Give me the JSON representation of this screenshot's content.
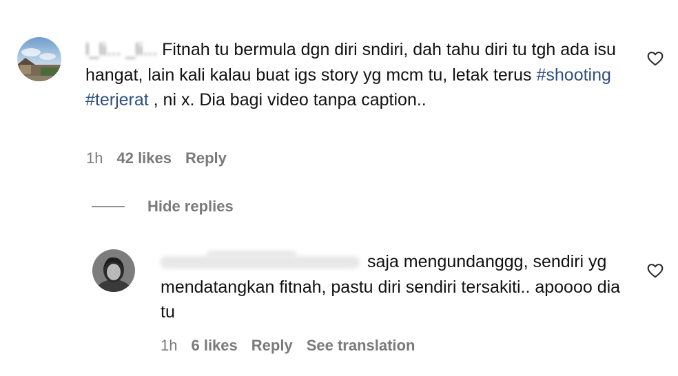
{
  "comments": [
    {
      "username": "l_li... _li...",
      "text_before": "Fitnah tu bermula dgn diri sndiri, dah tahu diri tu tgh ada isu hangat, lain kali kalau buat igs story yg mcm tu, letak terus ",
      "hashtags": [
        "#shooting",
        "#terjerat"
      ],
      "text_after": " , ni x. Dia bagi video tanpa caption..",
      "time": "1h",
      "likes": "42 likes",
      "reply_label": "Reply"
    }
  ],
  "replies_toggle": "Hide replies",
  "reply": {
    "username": "...",
    "text": "saja mengundanggg, sendiri yg mendatangkan fitnah, pastu diri sendiri tersakiti.. apoooo dia tu",
    "time": "1h",
    "likes": "6 likes",
    "reply_label": "Reply",
    "translate_label": "See translation"
  },
  "icons": {
    "like": "heart-outline-icon"
  },
  "colors": {
    "hashtag": "#2d4f86",
    "meta": "#7a7a7a"
  }
}
